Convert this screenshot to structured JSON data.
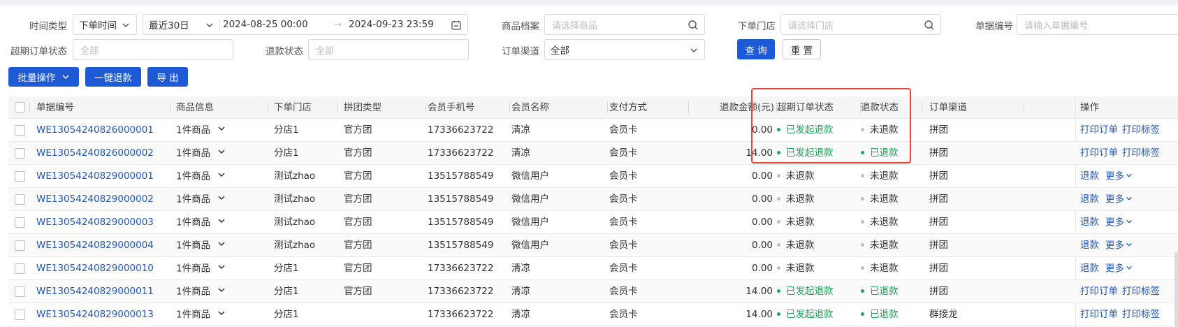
{
  "colors": {
    "primary": "#1e5ad6",
    "link": "#1f57c3",
    "status_green": "#1ea35a",
    "highlight": "#e8443a"
  },
  "filters": {
    "time_type_label": "时间类型",
    "time_type_value": "下单时间",
    "range_value": "最近30日",
    "date_start": "2024-08-25 00:00",
    "date_arrow": "→",
    "date_end": "2024-09-23 23:59",
    "product_label": "商品档案",
    "product_placeholder": "请选择商品",
    "store_label": "下单门店",
    "store_placeholder": "请选择门店",
    "doc_no_label": "单据编号",
    "doc_no_placeholder": "请输入单据编号",
    "overdue_label": "超期订单状态",
    "overdue_placeholder": "全部",
    "refund_label": "退款状态",
    "refund_placeholder": "全部",
    "channel_label": "订单渠道",
    "channel_value": "全部",
    "query_button": "查 询",
    "reset_button": "重 置"
  },
  "actions": {
    "batch_label": "批量操作",
    "one_click_refund": "一键退款",
    "export": "导 出"
  },
  "table": {
    "headers": {
      "doc_no": "单据编号",
      "product": "商品信息",
      "store": "下单门店",
      "group_type": "拼团类型",
      "phone": "会员手机号",
      "member": "会员名称",
      "payment": "支付方式",
      "refund_amount": "退款金额(元)",
      "overdue": "超期订单状态",
      "refund_status": "退款状态",
      "channel": "订单渠道",
      "ops": "操作"
    },
    "rows": [
      {
        "doc_no": "WE13054240826000001",
        "product": "1件商品",
        "store": "分店1",
        "group_type": "官方团",
        "phone": "17336623722",
        "member": "清凉",
        "payment": "会员卡",
        "amount": "0.00",
        "overdue": "已发起退款",
        "refund": "未退款",
        "channel": "拼团",
        "op1": "打印订单",
        "op2": "打印标签"
      },
      {
        "doc_no": "WE13054240826000002",
        "product": "1件商品",
        "store": "分店1",
        "group_type": "官方团",
        "phone": "17336623722",
        "member": "清凉",
        "payment": "会员卡",
        "amount": "14.00",
        "overdue": "已发起退款",
        "refund": "已退款",
        "channel": "拼团",
        "op1": "打印订单",
        "op2": "打印标签"
      },
      {
        "doc_no": "WE13054240829000001",
        "product": "1件商品",
        "store": "测试zhao",
        "group_type": "官方团",
        "phone": "13515788549",
        "member": "微信用户",
        "payment": "会员卡",
        "amount": "0.00",
        "overdue": "未退款",
        "refund": "未退款",
        "channel": "拼团",
        "op1": "退款",
        "op2": "更多"
      },
      {
        "doc_no": "WE13054240829000002",
        "product": "1件商品",
        "store": "测试zhao",
        "group_type": "官方团",
        "phone": "13515788549",
        "member": "微信用户",
        "payment": "会员卡",
        "amount": "0.00",
        "overdue": "未退款",
        "refund": "未退款",
        "channel": "拼团",
        "op1": "退款",
        "op2": "更多"
      },
      {
        "doc_no": "WE13054240829000003",
        "product": "1件商品",
        "store": "测试zhao",
        "group_type": "官方团",
        "phone": "13515788549",
        "member": "微信用户",
        "payment": "会员卡",
        "amount": "0.00",
        "overdue": "未退款",
        "refund": "未退款",
        "channel": "拼团",
        "op1": "退款",
        "op2": "更多"
      },
      {
        "doc_no": "WE13054240829000004",
        "product": "1件商品",
        "store": "测试zhao",
        "group_type": "官方团",
        "phone": "13515788549",
        "member": "微信用户",
        "payment": "会员卡",
        "amount": "0.00",
        "overdue": "未退款",
        "refund": "未退款",
        "channel": "拼团",
        "op1": "退款",
        "op2": "更多"
      },
      {
        "doc_no": "WE13054240829000010",
        "product": "1件商品",
        "store": "分店1",
        "group_type": "官方团",
        "phone": "17336623722",
        "member": "清凉",
        "payment": "会员卡",
        "amount": "0.00",
        "overdue": "未退款",
        "refund": "未退款",
        "channel": "拼团",
        "op1": "退款",
        "op2": "更多"
      },
      {
        "doc_no": "WE13054240829000011",
        "product": "1件商品",
        "store": "分店1",
        "group_type": "官方团",
        "phone": "17336623722",
        "member": "清凉",
        "payment": "会员卡",
        "amount": "14.00",
        "overdue": "已发起退款",
        "refund": "已退款",
        "channel": "拼团",
        "op1": "打印订单",
        "op2": "打印标签"
      },
      {
        "doc_no": "WE13054240829000013",
        "product": "1件商品",
        "store": "分店1",
        "group_type": "",
        "phone": "17336623722",
        "member": "清凉",
        "payment": "会员卡",
        "amount": "14.00",
        "overdue": "已发起退款",
        "refund": "已退款",
        "channel": "群接龙",
        "op1": "打印订单",
        "op2": "打印标签"
      }
    ]
  }
}
